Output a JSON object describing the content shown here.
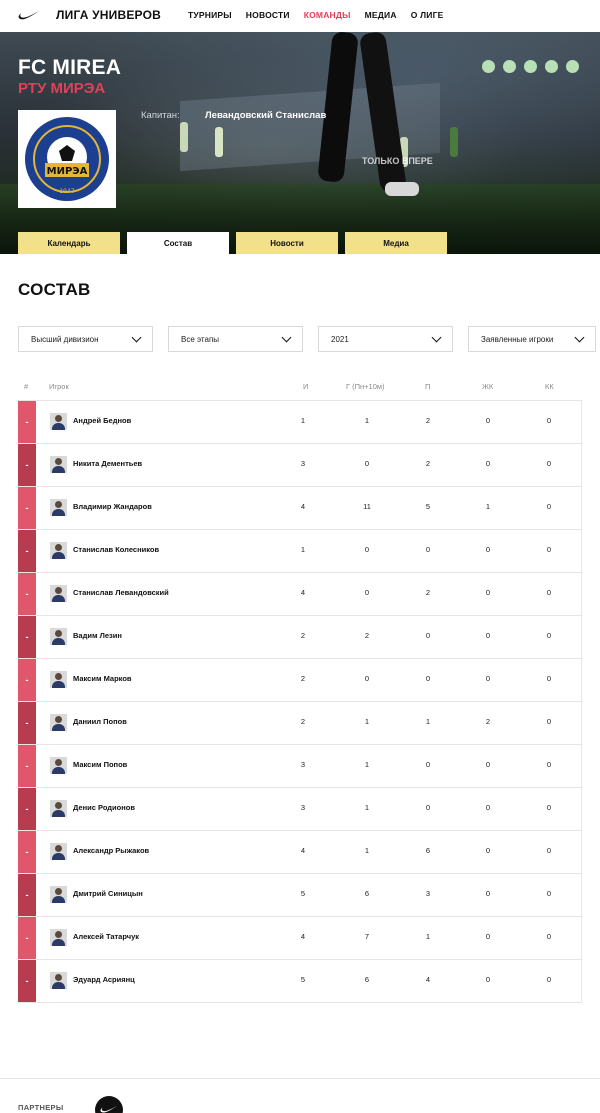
{
  "nav": {
    "brand": "ЛИГА УНИВЕРОВ",
    "items": [
      {
        "label": "ТУРНИРЫ",
        "active": false
      },
      {
        "label": "НОВОСТИ",
        "active": false
      },
      {
        "label": "КОМАНДЫ",
        "active": true
      },
      {
        "label": "МЕДИА",
        "active": false
      },
      {
        "label": "О ЛИГЕ",
        "active": false
      }
    ]
  },
  "team": {
    "name": "FC MIREA",
    "subtitle": "РТУ МИРЭА",
    "captain_label": "Капитан:",
    "captain_name": "Левандовский Станислав",
    "logo_text": "МИРЭА",
    "logo_year": "1947",
    "wall_text": "ТОЛЬКО ВПЕРЕ",
    "tabs": [
      {
        "label": "Календарь",
        "active": false
      },
      {
        "label": "Состав",
        "active": true
      },
      {
        "label": "Новости",
        "active": false
      },
      {
        "label": "Медиа",
        "active": false
      }
    ]
  },
  "section_title": "СОСТАВ",
  "filters": [
    {
      "value": "Высший дивизион"
    },
    {
      "value": "Все этапы"
    },
    {
      "value": "2021"
    },
    {
      "value": "Заявленные игроки"
    }
  ],
  "table": {
    "headers": {
      "num": "#",
      "player": "Игрок",
      "games": "И",
      "goals": "Г (Пн+10м)",
      "assists": "П",
      "yellow": "ЖК",
      "red": "КК"
    },
    "rows": [
      {
        "num": "-",
        "name": "Андрей Беднов",
        "games": "1",
        "goals": "1",
        "assists": "2",
        "yellow": "0",
        "red": "0"
      },
      {
        "num": "-",
        "name": "Никита Дементьев",
        "games": "3",
        "goals": "0",
        "assists": "2",
        "yellow": "0",
        "red": "0"
      },
      {
        "num": "-",
        "name": "Владимир Жандаров",
        "games": "4",
        "goals": "11",
        "assists": "5",
        "yellow": "1",
        "red": "0"
      },
      {
        "num": "-",
        "name": "Станислав Колесников",
        "games": "1",
        "goals": "0",
        "assists": "0",
        "yellow": "0",
        "red": "0"
      },
      {
        "num": "-",
        "name": "Станислав Левандовский",
        "games": "4",
        "goals": "0",
        "assists": "2",
        "yellow": "0",
        "red": "0"
      },
      {
        "num": "-",
        "name": "Вадим Лезин",
        "games": "2",
        "goals": "2",
        "assists": "0",
        "yellow": "0",
        "red": "0"
      },
      {
        "num": "-",
        "name": "Максим Марков",
        "games": "2",
        "goals": "0",
        "assists": "0",
        "yellow": "0",
        "red": "0"
      },
      {
        "num": "-",
        "name": "Даниил Попов",
        "games": "2",
        "goals": "1",
        "assists": "1",
        "yellow": "2",
        "red": "0"
      },
      {
        "num": "-",
        "name": "Максим Попов",
        "games": "3",
        "goals": "1",
        "assists": "0",
        "yellow": "0",
        "red": "0"
      },
      {
        "num": "-",
        "name": "Денис Родионов",
        "games": "3",
        "goals": "1",
        "assists": "0",
        "yellow": "0",
        "red": "0"
      },
      {
        "num": "-",
        "name": "Александр Рыжаков",
        "games": "4",
        "goals": "1",
        "assists": "6",
        "yellow": "0",
        "red": "0"
      },
      {
        "num": "-",
        "name": "Дмитрий Синицын",
        "games": "5",
        "goals": "6",
        "assists": "3",
        "yellow": "0",
        "red": "0"
      },
      {
        "num": "-",
        "name": "Алексей Татарчук",
        "games": "4",
        "goals": "7",
        "assists": "1",
        "yellow": "0",
        "red": "0"
      },
      {
        "num": "-",
        "name": "Эдуард Асриянц",
        "games": "5",
        "goals": "6",
        "assists": "4",
        "yellow": "0",
        "red": "0"
      }
    ]
  },
  "footer": {
    "partners_label": "ПАРТНЕРЫ"
  },
  "colors": {
    "accent": "#e0405a",
    "tab_yellow": "#f2e08a",
    "strip_light": "#e0566a",
    "strip_dark": "#b83c4f",
    "slider_dot": "#b7e0b5"
  }
}
